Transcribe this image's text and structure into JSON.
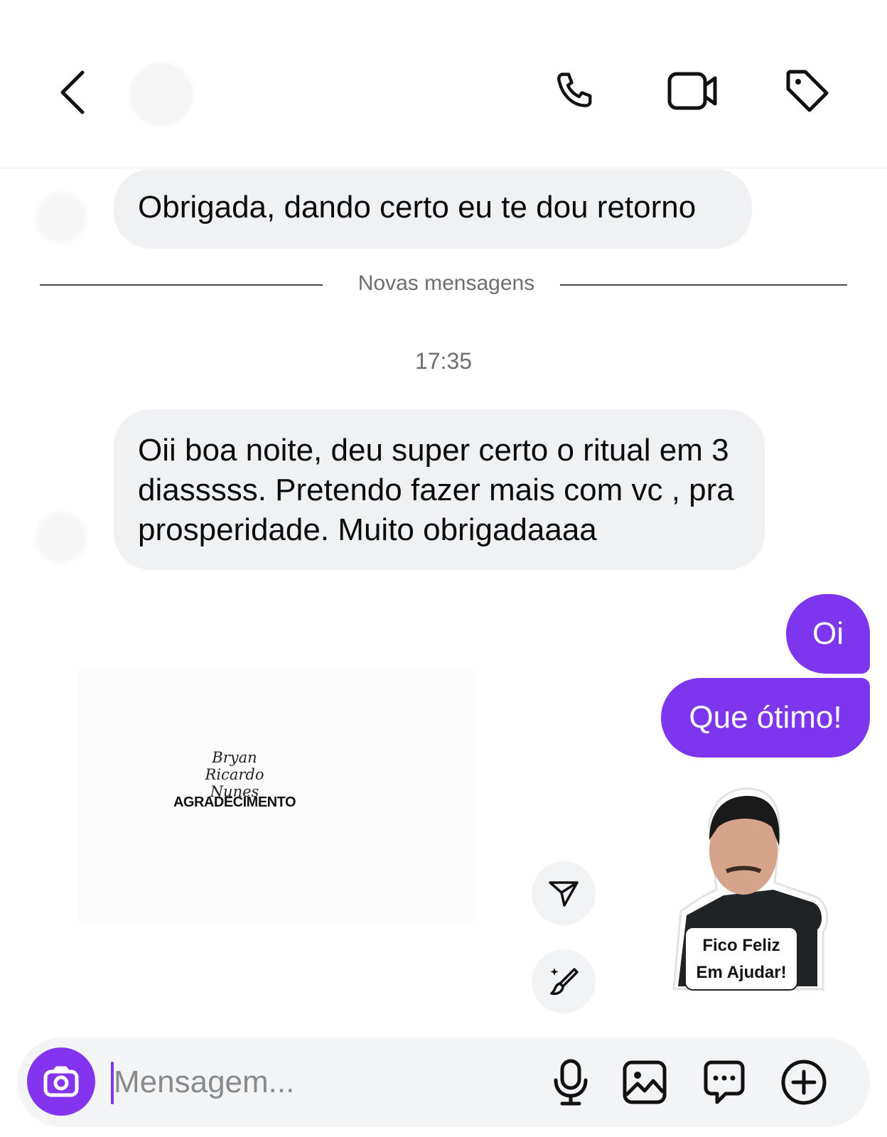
{
  "header": {
    "back_icon": "chevron-left-icon",
    "actions": [
      "phone-icon",
      "video-camera-icon",
      "tag-icon"
    ]
  },
  "messages": {
    "m1": "Obrigada, dando certo eu te dou retorno",
    "divider_label": "Novas mensagens",
    "timestamp": "17:35",
    "m2": "Oii boa noite, deu super certo o ritual em 3 diasssss. Pretendo fazer mais com vc , pra prosperidade. Muito obrigadaaaa",
    "m3": "Oi",
    "m4": "Que ótimo!"
  },
  "shared_sticker": {
    "name_line1": "Bryan Ricardo",
    "name_line2": "Nunes",
    "subtitle": "AGRADECIMENTO"
  },
  "photo_sticker": {
    "line1": "Fico Feliz",
    "line2": "Em Ajudar!"
  },
  "composer": {
    "placeholder": "Mensagem...",
    "icons": [
      "camera-icon",
      "microphone-icon",
      "gallery-icon",
      "chat-bubble-icon",
      "plus-icon"
    ]
  },
  "colors": {
    "accent": "#7d36ee",
    "incoming_bubble": "#eff1f3",
    "meta_text": "#6e6e6e"
  }
}
